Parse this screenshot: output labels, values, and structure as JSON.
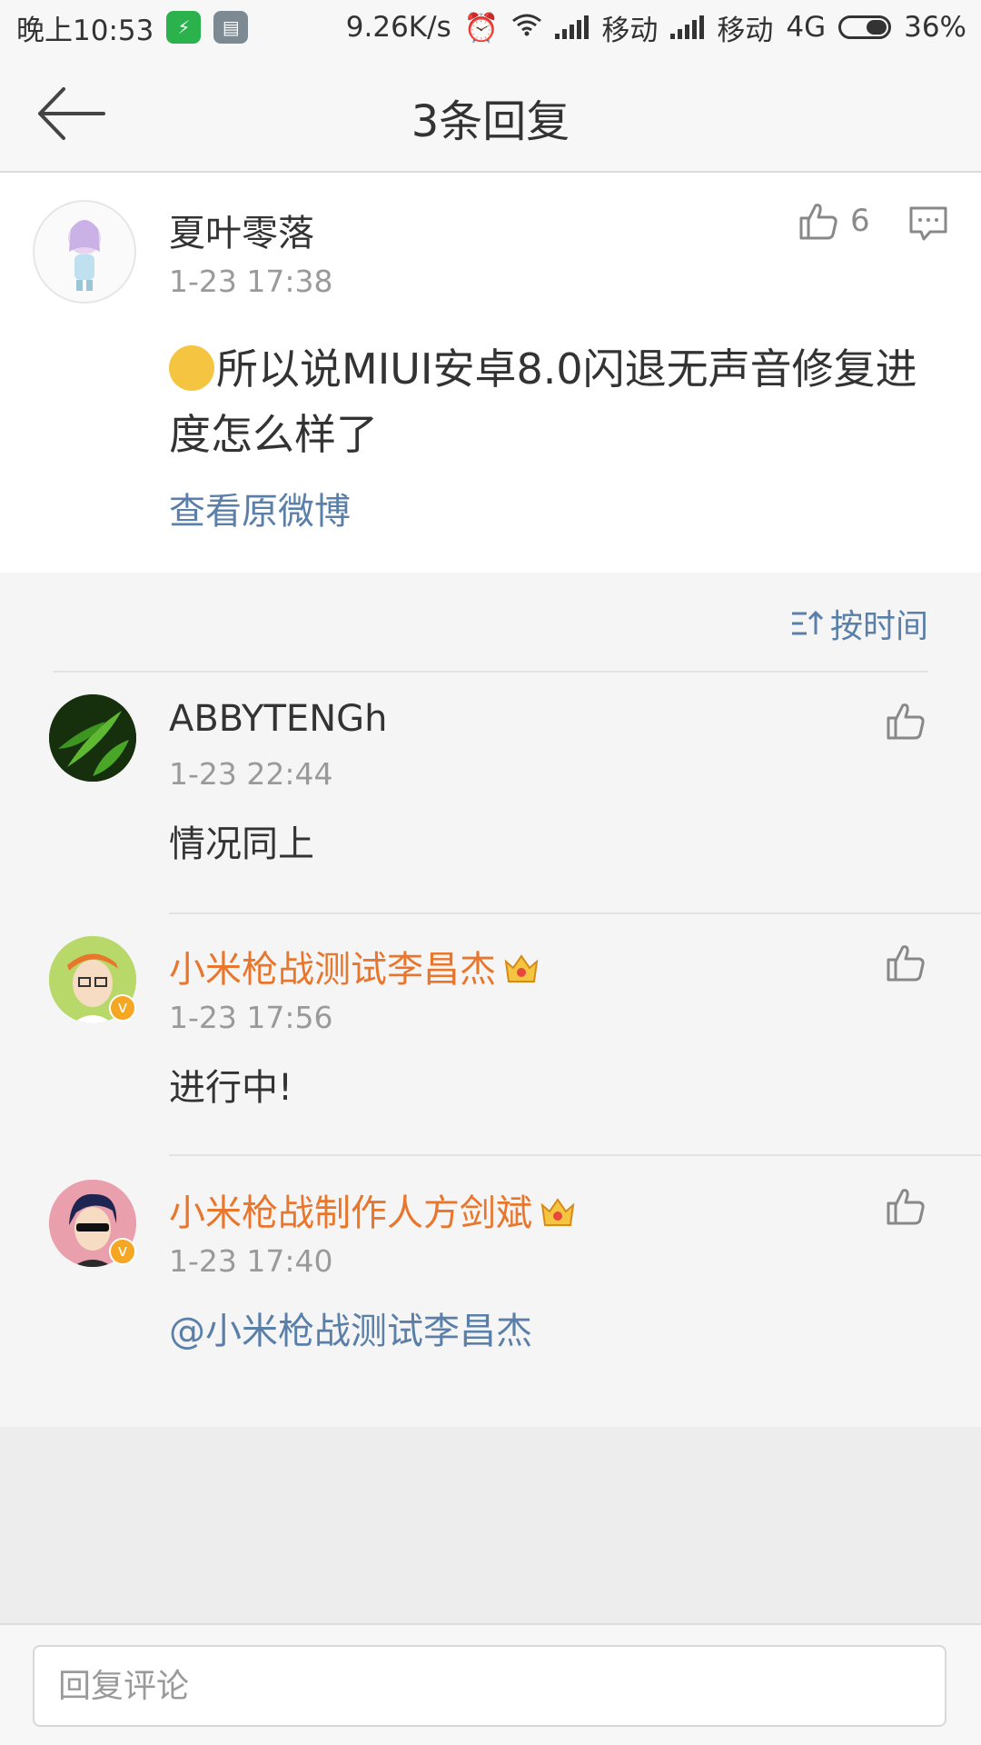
{
  "status_bar": {
    "time": "晚上10:53",
    "speed": "9.26K/s",
    "carrier1": "移动",
    "carrier2": "移动",
    "network": "4G",
    "battery": "36%"
  },
  "header": {
    "title": "3条回复"
  },
  "main_comment": {
    "username": "夏叶零落",
    "time": "1-23 17:38",
    "like_count": "6",
    "text": "所以说MIUI安卓8.0闪退无声音修复进度怎么样了",
    "view_original": "查看原微博"
  },
  "sort": {
    "label": "按时间"
  },
  "replies": [
    {
      "username": "ABBYTENGh",
      "time": "1-23 22:44",
      "text": "情况同上"
    },
    {
      "username": "小米枪战测试李昌杰",
      "time": "1-23 17:56",
      "text": "进行中!"
    },
    {
      "username": "小米枪战制作人方剑斌",
      "time": "1-23 17:40",
      "text": "@小米枪战测试李昌杰"
    }
  ],
  "input": {
    "placeholder": "回复评论"
  },
  "colors": {
    "link": "#5a7fa8",
    "verified_name": "#e8762c"
  }
}
